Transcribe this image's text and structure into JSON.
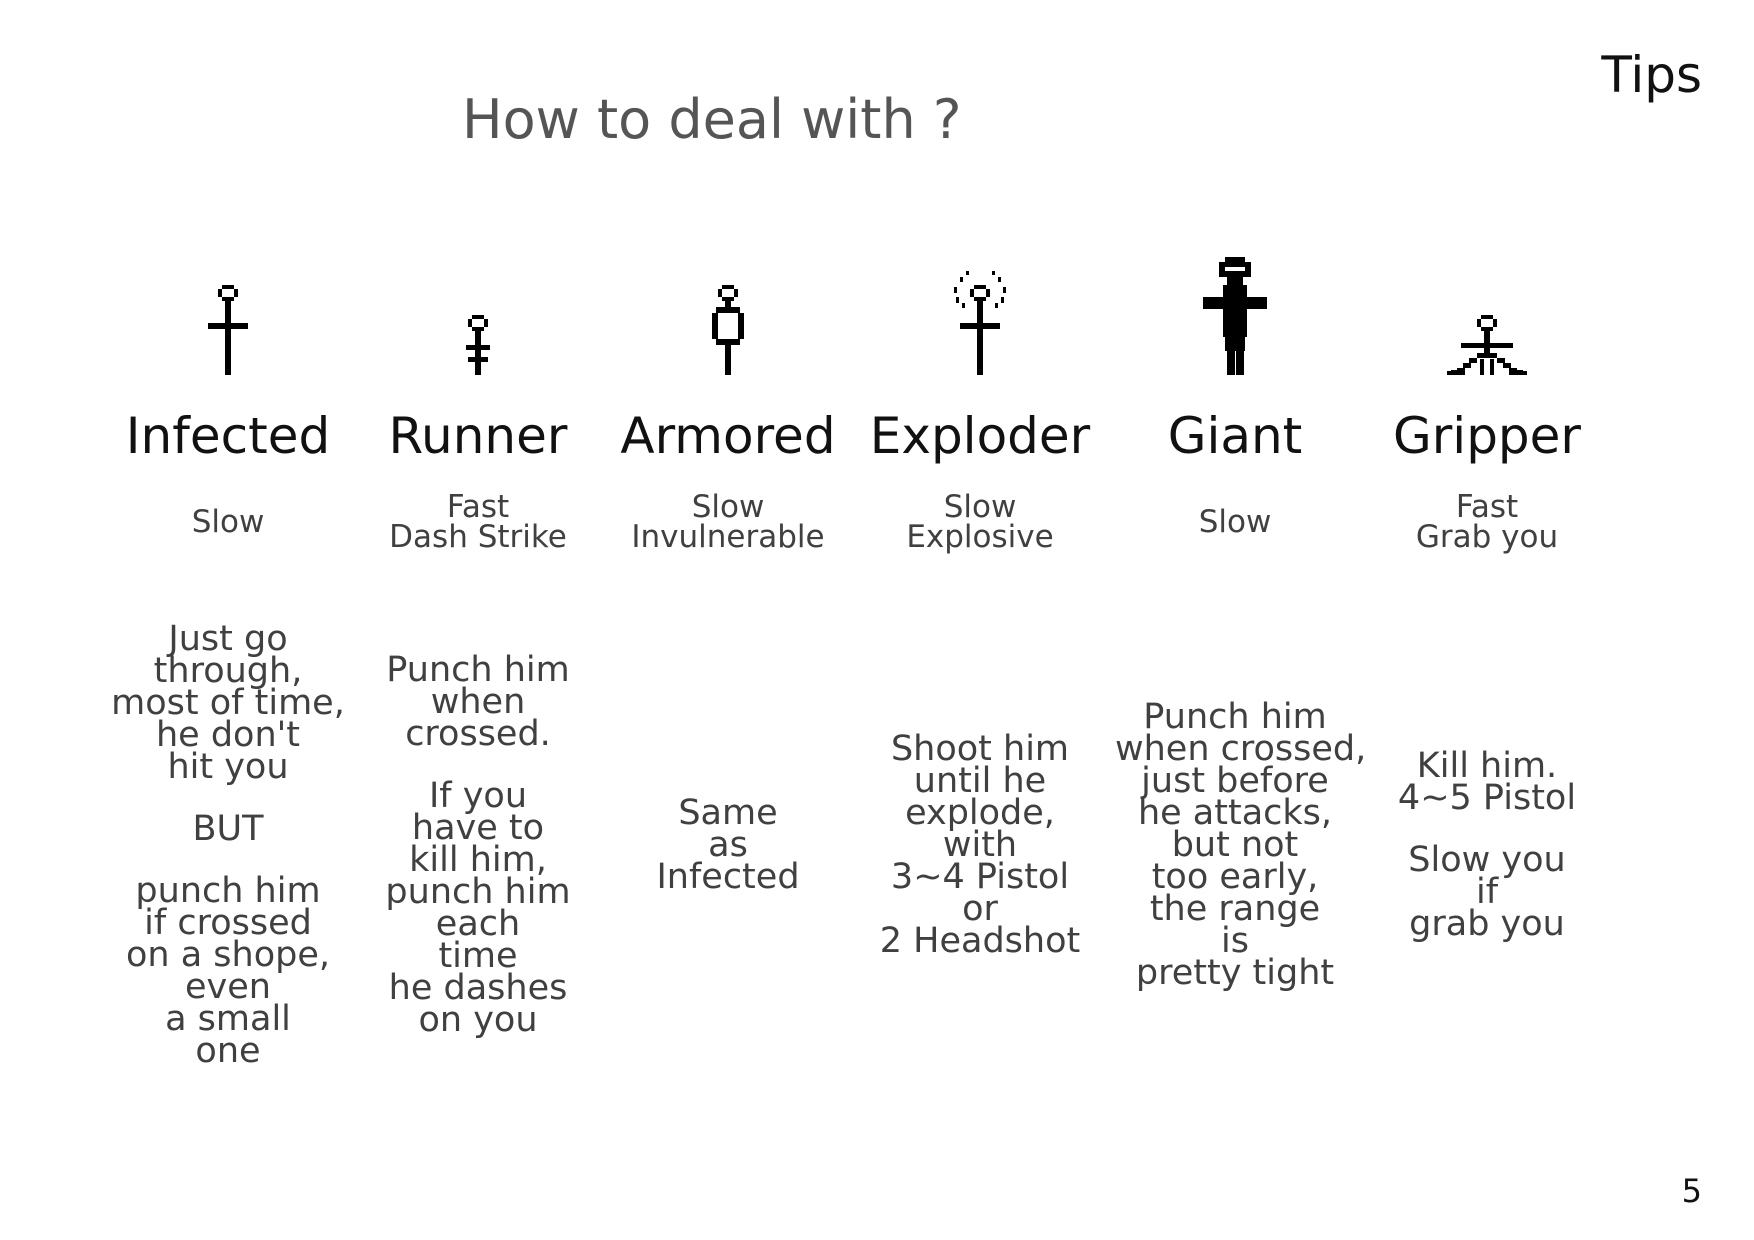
{
  "slide": {
    "label": "Tips",
    "page_number": "5"
  },
  "title": "How to deal with ?",
  "enemies": [
    {
      "name": "Infected",
      "icon": "infected-sprite-icon",
      "traits": [
        "Slow"
      ],
      "tip": [
        [
          "Just go",
          "through,",
          "most of time,",
          "he don't",
          "hit you"
        ],
        [
          "BUT"
        ],
        [
          "punch him",
          "if crossed",
          "on a shope,",
          "even",
          "a small",
          "one"
        ]
      ]
    },
    {
      "name": "Runner",
      "icon": "runner-sprite-icon",
      "traits": [
        "Fast",
        "Dash Strike"
      ],
      "tip": [
        [
          "Punch him",
          "when",
          "crossed."
        ],
        [
          "If you",
          "have to",
          "kill him,",
          "punch him",
          "each",
          "time",
          "he dashes",
          "on you"
        ]
      ]
    },
    {
      "name": "Armored",
      "icon": "armored-sprite-icon",
      "traits": [
        "Slow",
        "Invulnerable"
      ],
      "tip": [
        [
          "Same",
          "as",
          "Infected"
        ]
      ]
    },
    {
      "name": "Exploder",
      "icon": "exploder-sprite-icon",
      "traits": [
        "Slow",
        "Explosive"
      ],
      "tip": [
        [
          "Shoot him",
          "until he",
          "explode,",
          "with",
          "3~4 Pistol",
          "or",
          "2 Headshot"
        ]
      ]
    },
    {
      "name": "Giant",
      "icon": "giant-sprite-icon",
      "traits": [
        "Slow"
      ],
      "tip": [
        [
          "Punch him",
          "when crossed,",
          "just before",
          "he attacks,",
          "but not",
          "too early,",
          "the range",
          "is",
          "pretty tight"
        ]
      ]
    },
    {
      "name": "Gripper",
      "icon": "gripper-sprite-icon",
      "traits": [
        "Fast",
        "Grab you"
      ],
      "tip": [
        [
          "Kill him.",
          "4~5 Pistol"
        ],
        [
          "Slow you",
          "if",
          "grab you"
        ]
      ]
    }
  ]
}
